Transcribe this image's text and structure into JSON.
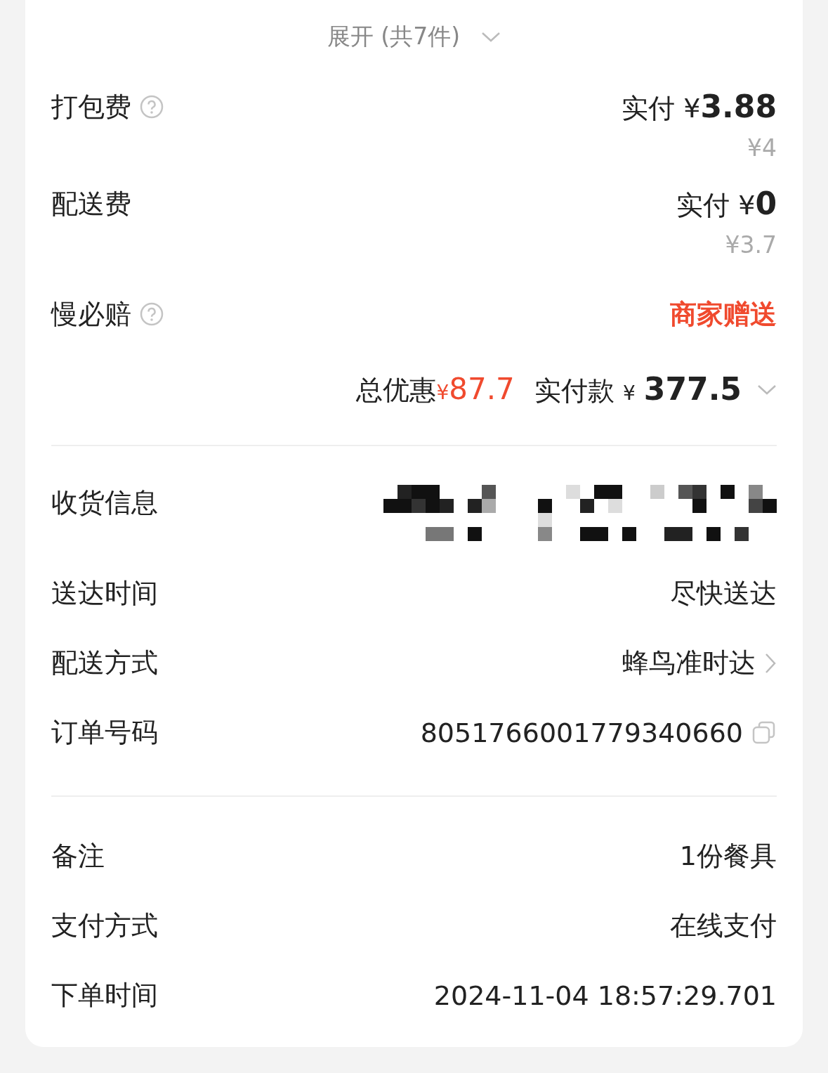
{
  "expand": {
    "label": "展开 (共7件)"
  },
  "fees": [
    {
      "kind": "fee",
      "label": "打包费",
      "help": true,
      "paid_label": "实付",
      "currency": "¥",
      "paid": "3.88",
      "original": "¥4"
    },
    {
      "kind": "fee",
      "label": "配送费",
      "help": false,
      "paid_label": "实付",
      "currency": "¥",
      "paid": "0",
      "original": "¥3.7"
    },
    {
      "kind": "gift",
      "label": "慢必赔",
      "help": true,
      "value": "商家赠送"
    }
  ],
  "summary": {
    "discount_label": "总优惠",
    "discount_currency": "¥",
    "discount": "87.7",
    "total_label": "实付款",
    "total_currency": "¥",
    "total": "377.5"
  },
  "delivery": [
    {
      "kind": "redacted",
      "label": "收货信息"
    },
    {
      "kind": "text",
      "label": "送达时间",
      "value": "尽快送达"
    },
    {
      "kind": "link",
      "label": "配送方式",
      "value": "蜂鸟准时达"
    },
    {
      "kind": "copy",
      "label": "订单号码",
      "value": "8051766001779340660"
    }
  ],
  "extra": [
    {
      "kind": "text",
      "label": "备注",
      "value": "1份餐具"
    },
    {
      "kind": "text",
      "label": "支付方式",
      "value": "在线支付"
    },
    {
      "kind": "text",
      "label": "下单时间",
      "value": "2024-11-04 18:57:29.701"
    }
  ]
}
